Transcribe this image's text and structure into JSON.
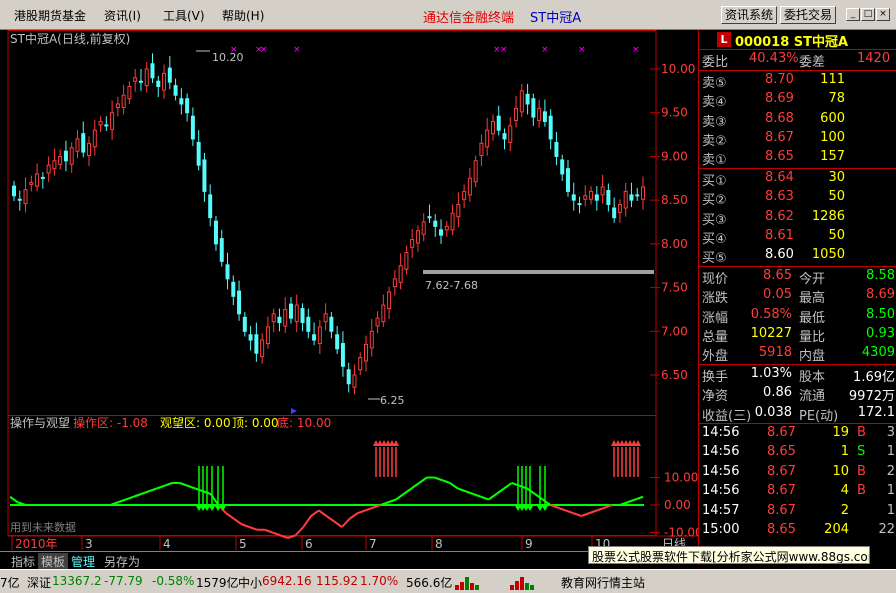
{
  "menubar": {
    "items": [
      "港股期货基金",
      "资讯(I)",
      "工具(V)",
      "帮助(H)"
    ],
    "title": "通达信金融终端",
    "stock_title": "ST中冠A",
    "buttons": [
      "资讯系统",
      "委托交易"
    ],
    "window_controls": [
      "_",
      "□",
      "×"
    ]
  },
  "chart": {
    "header": "ST中冠A(日线,前复权)",
    "price_ticks": [
      "10.00",
      "9.50",
      "9.00",
      "8.50",
      "8.00",
      "7.50",
      "7.00",
      "6.50"
    ],
    "high_label": "10.20",
    "low_label": "6.25",
    "range_label": "7.62-7.68",
    "date_labels": [
      "2010年",
      "3",
      "4",
      "5",
      "6",
      "7",
      "8",
      "9",
      "10"
    ],
    "period_label": "日线",
    "indicator": {
      "name": "操作与观望",
      "zone1": "操作区: -1.08",
      "zone2": "观望区: 0.00",
      "top": "顶: 0.00",
      "bottom": "底: 10.00",
      "ticks": [
        "10.00",
        "0.00",
        "-10.00"
      ],
      "watermark": "用到未来数据"
    }
  },
  "chart_data": {
    "type": "candlestick",
    "ylim": [
      6.25,
      10.2
    ],
    "close": [
      8.55,
      8.5,
      8.62,
      8.7,
      8.8,
      8.75,
      8.9,
      8.95,
      9.0,
      8.95,
      9.1,
      9.2,
      9.05,
      9.15,
      9.3,
      9.4,
      9.35,
      9.5,
      9.6,
      9.7,
      9.8,
      9.9,
      9.85,
      10.0,
      9.9,
      9.8,
      9.95,
      9.85,
      9.7,
      9.6,
      9.5,
      9.2,
      8.9,
      8.6,
      8.3,
      8.0,
      7.8,
      7.6,
      7.4,
      7.2,
      7.0,
      6.9,
      6.75,
      6.9,
      7.05,
      7.2,
      7.1,
      7.25,
      7.15,
      7.3,
      7.1,
      7.0,
      6.9,
      7.05,
      7.2,
      7.0,
      6.8,
      6.6,
      6.4,
      6.5,
      6.7,
      6.85,
      7.0,
      7.15,
      7.3,
      7.45,
      7.6,
      7.75,
      7.9,
      8.05,
      8.15,
      8.25,
      8.3,
      8.2,
      8.1,
      8.2,
      8.35,
      8.45,
      8.6,
      8.75,
      8.95,
      9.15,
      9.3,
      9.4,
      9.3,
      9.2,
      9.35,
      9.55,
      9.75,
      9.6,
      9.45,
      9.55,
      9.4,
      9.2,
      9.0,
      8.8,
      8.6,
      8.5,
      8.45,
      8.55,
      8.6,
      8.5,
      8.65,
      8.45,
      8.3,
      8.45,
      8.6,
      8.5,
      8.55,
      8.65
    ],
    "indicator_series": [
      {
        "name": "操作区",
        "values": [
          3,
          1,
          0,
          0,
          0,
          0,
          0,
          0,
          0,
          0,
          0,
          0,
          0,
          0,
          1,
          2,
          3,
          4,
          5,
          6,
          7,
          8,
          8,
          7,
          6,
          5,
          4,
          0,
          -3,
          -5,
          -7,
          -8,
          -9,
          -9,
          -10,
          -11,
          -12,
          -11,
          -8,
          -4,
          -2,
          -4,
          -6,
          -8,
          -5,
          -3,
          -2,
          -1,
          0,
          1,
          2,
          4,
          6,
          8,
          10,
          10,
          9,
          8,
          6,
          5,
          4,
          3,
          2,
          4,
          6,
          8,
          7,
          6,
          4,
          2,
          0,
          -1,
          -2,
          -3,
          -4,
          -3,
          -2,
          -1,
          0,
          0,
          1,
          2,
          3
        ]
      },
      {
        "name": "观望区",
        "values": [
          0,
          0,
          0,
          0,
          0,
          0,
          0,
          0,
          0,
          0,
          0,
          0,
          0,
          0,
          0,
          0,
          0,
          0,
          0,
          0,
          0,
          0,
          0,
          0,
          0,
          0,
          0,
          0,
          0,
          0,
          0,
          0,
          0,
          0,
          0,
          0,
          0,
          0,
          0,
          0,
          0,
          0,
          0,
          0,
          0,
          0,
          0,
          0,
          0,
          0,
          0,
          0,
          0,
          0,
          0,
          0,
          0,
          0,
          0,
          0,
          0,
          0,
          0,
          0,
          0,
          0,
          0,
          0,
          0,
          0,
          0,
          0,
          0,
          0,
          0,
          0,
          0,
          0,
          0,
          0,
          0,
          0,
          0
        ]
      }
    ]
  },
  "quote": {
    "code_icon": "L",
    "code": "000018 ST中冠A",
    "webi_label": "委比",
    "webi": "40.43%",
    "weicha_label": "委差",
    "weicha": "1420",
    "asks": [
      {
        "label": "卖⑤",
        "price": "8.70",
        "vol": "111"
      },
      {
        "label": "卖④",
        "price": "8.69",
        "vol": "78"
      },
      {
        "label": "卖③",
        "price": "8.68",
        "vol": "600"
      },
      {
        "label": "卖②",
        "price": "8.67",
        "vol": "100"
      },
      {
        "label": "卖①",
        "price": "8.65",
        "vol": "157"
      }
    ],
    "bids": [
      {
        "label": "买①",
        "price": "8.64",
        "vol": "30"
      },
      {
        "label": "买②",
        "price": "8.63",
        "vol": "50"
      },
      {
        "label": "买③",
        "price": "8.62",
        "vol": "1286"
      },
      {
        "label": "买④",
        "price": "8.61",
        "vol": "50"
      },
      {
        "label": "买⑤",
        "price": "8.60",
        "vol": "1050"
      }
    ],
    "stats": [
      {
        "l1": "现价",
        "v1": "8.65",
        "l2": "今开",
        "v2": "8.58"
      },
      {
        "l1": "涨跌",
        "v1": "0.05",
        "l2": "最高",
        "v2": "8.69"
      },
      {
        "l1": "涨幅",
        "v1": "0.58%",
        "l2": "最低",
        "v2": "8.50"
      },
      {
        "l1": "总量",
        "v1": "10227",
        "l2": "量比",
        "v2": "0.93"
      },
      {
        "l1": "外盘",
        "v1": "5918",
        "l2": "内盘",
        "v2": "4309"
      }
    ],
    "stats2": [
      {
        "l1": "换手",
        "v1": "1.03%",
        "l2": "股本",
        "v2": "1.69亿"
      },
      {
        "l1": "净资",
        "v1": "0.86",
        "l2": "流通",
        "v2": "9972万"
      },
      {
        "l1": "收益(三)",
        "v1": "0.038",
        "l2": "PE(动)",
        "v2": "172.1"
      }
    ],
    "ticks": [
      {
        "time": "14:56",
        "price": "8.67",
        "vol": "19",
        "dir": "B",
        "n": "3"
      },
      {
        "time": "14:56",
        "price": "8.65",
        "vol": "1",
        "dir": "S",
        "n": "1"
      },
      {
        "time": "14:56",
        "price": "8.67",
        "vol": "10",
        "dir": "B",
        "n": "2"
      },
      {
        "time": "14:56",
        "price": "8.67",
        "vol": "4",
        "dir": "B",
        "n": "1"
      },
      {
        "time": "14:57",
        "price": "8.67",
        "vol": "2",
        "dir": "",
        "n": "1"
      },
      {
        "time": "15:00",
        "price": "8.65",
        "vol": "204",
        "dir": "",
        "n": "22"
      }
    ]
  },
  "tabs": [
    "指标",
    "模板",
    "管理",
    "另存为"
  ],
  "adbar": "股票公式股票软件下载[分析家公式网www.88gs.com]",
  "status": {
    "left": "7亿",
    "sz_label": "深证",
    "sz_val": "13367.2",
    "sz_chg": "-77.79",
    "sz_pct": "-0.58%",
    "sz_amt": "1579亿",
    "zx_label": "中小",
    "zx_val": "6942.16",
    "zx_chg": "115.92",
    "zx_pct": "1.70%",
    "zx_amt": "566.6亿",
    "right": "教育网行情主站"
  },
  "colors": {
    "up": "#ff3c3c",
    "down": "#54fcfc",
    "green": "#00ff00",
    "yellow": "#ffff00",
    "white": "#ffffff",
    "border": "#c00000"
  }
}
